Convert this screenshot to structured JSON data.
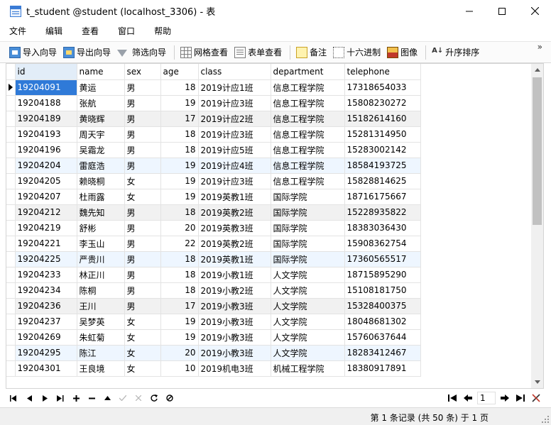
{
  "window": {
    "title": "t_student @student (localhost_3306) - 表",
    "minimize_icon": "minimize-icon",
    "maximize_icon": "maximize-icon",
    "close_icon": "close-icon"
  },
  "menu": [
    "文件",
    "编辑",
    "查看",
    "窗口",
    "帮助"
  ],
  "toolbar": {
    "import_wizard": "导入向导",
    "export_wizard": "导出向导",
    "filter_wizard": "筛选向导",
    "grid_view": "网格查看",
    "form_view": "表单查看",
    "memo": "备注",
    "hex": "十六进制",
    "image": "图像",
    "sort": "升序排序",
    "more": "»"
  },
  "table": {
    "columns": [
      "id",
      "name",
      "sex",
      "age",
      "class",
      "department",
      "telephone"
    ],
    "rows": [
      [
        "19204091",
        "黄运",
        "男",
        "18",
        "2019计应1班",
        "信息工程学院",
        "17318654033"
      ],
      [
        "19204188",
        "张航",
        "男",
        "19",
        "2019计应3班",
        "信息工程学院",
        "15808230272"
      ],
      [
        "19204189",
        "黄晓辉",
        "男",
        "17",
        "2019计应2班",
        "信息工程学院",
        "15182614160"
      ],
      [
        "19204193",
        "周天宇",
        "男",
        "18",
        "2019计应3班",
        "信息工程学院",
        "15281314950"
      ],
      [
        "19204196",
        "吴霜龙",
        "男",
        "18",
        "2019计应5班",
        "信息工程学院",
        "15283002142"
      ],
      [
        "19204204",
        "雷庭浩",
        "男",
        "19",
        "2019计应4班",
        "信息工程学院",
        "18584193725"
      ],
      [
        "19204205",
        "赖晓桐",
        "女",
        "19",
        "2019计应3班",
        "信息工程学院",
        "15828814625"
      ],
      [
        "19204207",
        "杜雨露",
        "女",
        "19",
        "2019英教1班",
        "国际学院",
        "18716175667"
      ],
      [
        "19204212",
        "魏先知",
        "男",
        "18",
        "2019英教2班",
        "国际学院",
        "15228935822"
      ],
      [
        "19204219",
        "舒彬",
        "男",
        "20",
        "2019英教3班",
        "国际学院",
        "18383036430"
      ],
      [
        "19204221",
        "李玉山",
        "男",
        "22",
        "2019英教2班",
        "国际学院",
        "15908362754"
      ],
      [
        "19204225",
        "严贵川",
        "男",
        "18",
        "2019英教1班",
        "国际学院",
        "17360565517"
      ],
      [
        "19204233",
        "林正川",
        "男",
        "18",
        "2019小教1班",
        "人文学院",
        "18715895290"
      ],
      [
        "19204234",
        "陈桐",
        "男",
        "18",
        "2019小教2班",
        "人文学院",
        "15108181750"
      ],
      [
        "19204236",
        "王川",
        "男",
        "17",
        "2019小教3班",
        "人文学院",
        "15328400375"
      ],
      [
        "19204237",
        "吴梦英",
        "女",
        "19",
        "2019小教3班",
        "人文学院",
        "18048681302"
      ],
      [
        "19204269",
        "朱虹菊",
        "女",
        "19",
        "2019小教3班",
        "人文学院",
        "15760637644"
      ],
      [
        "19204295",
        "陈江",
        "女",
        "20",
        "2019小教3班",
        "人文学院",
        "18283412467"
      ],
      [
        "19204301",
        "王良境",
        "女",
        "10",
        "2019机电3班",
        "机械工程学院",
        "18380917891"
      ]
    ]
  },
  "navigation": {
    "page_value": "1",
    "status": "第 1 条记录 (共 50 条) 于 1 页"
  },
  "colors": {
    "selection": "#2f7ad8",
    "header_selected": "#e2edf8",
    "row_alt": "#f1f1f1",
    "row_blue": "#eef6ff"
  }
}
